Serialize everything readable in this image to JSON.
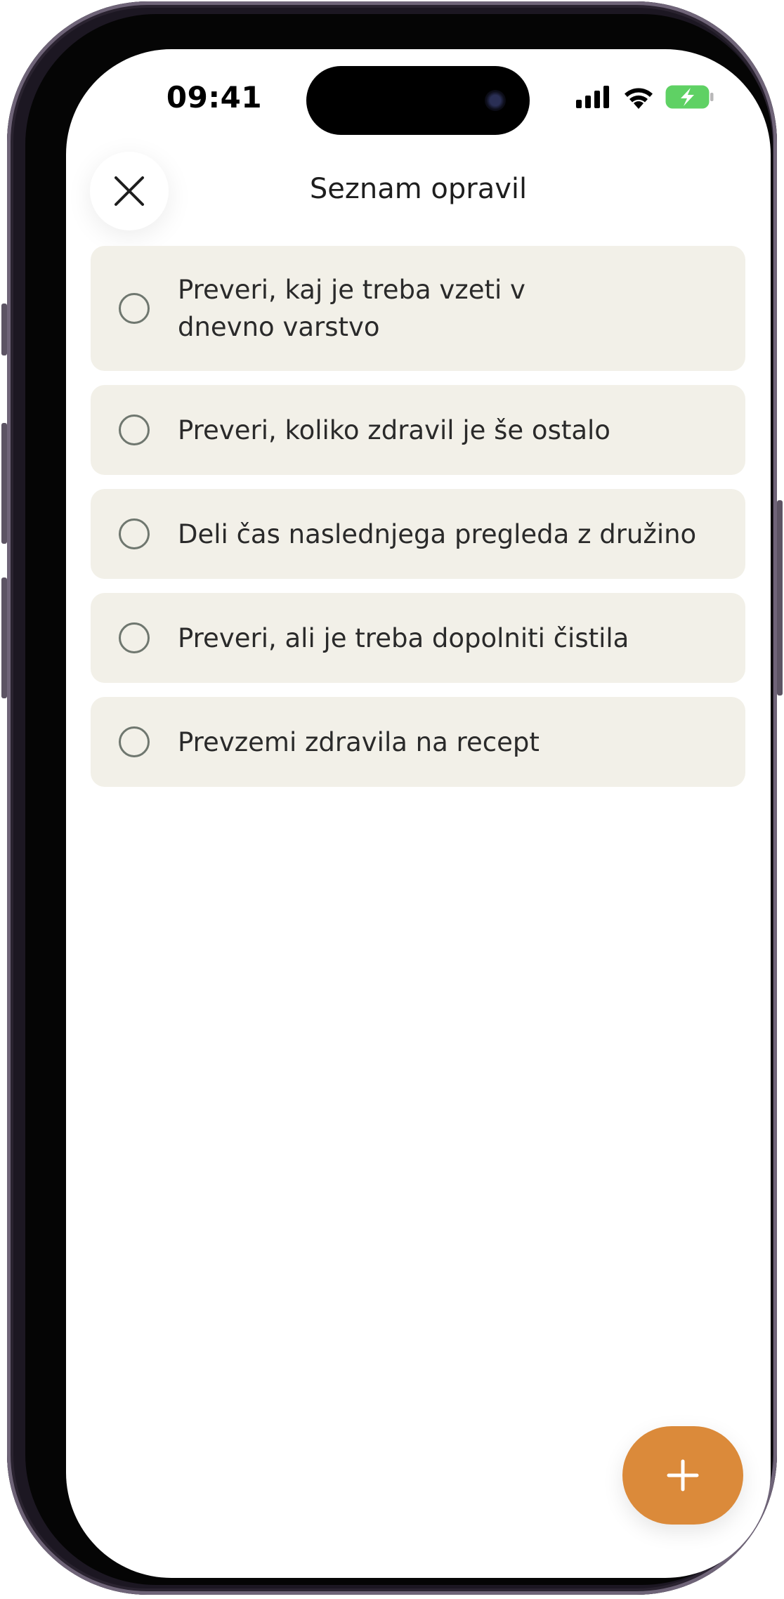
{
  "status_bar": {
    "time": "09:41"
  },
  "header": {
    "title": "Seznam opravil"
  },
  "tasks": [
    {
      "label": "Preveri, kaj je treba vzeti v dnevno varstvo",
      "done": false
    },
    {
      "label": "Preveri, koliko zdravil je še ostalo",
      "done": false
    },
    {
      "label": "Deli čas naslednjega pregleda z družino",
      "done": false
    },
    {
      "label": "Preveri, ali je treba dopolniti čistila",
      "done": false
    },
    {
      "label": "Prevzemi zdravila na recept",
      "done": false
    }
  ],
  "icons": {
    "close": "close-icon",
    "add": "plus-icon",
    "signal": "cellular-signal-icon",
    "wifi": "wifi-icon",
    "battery": "battery-charging-icon"
  },
  "colors": {
    "accent": "#db8a3a",
    "card_background": "#f2f0e8",
    "battery_green": "#5fd164",
    "radio_border": "#6f776f"
  }
}
